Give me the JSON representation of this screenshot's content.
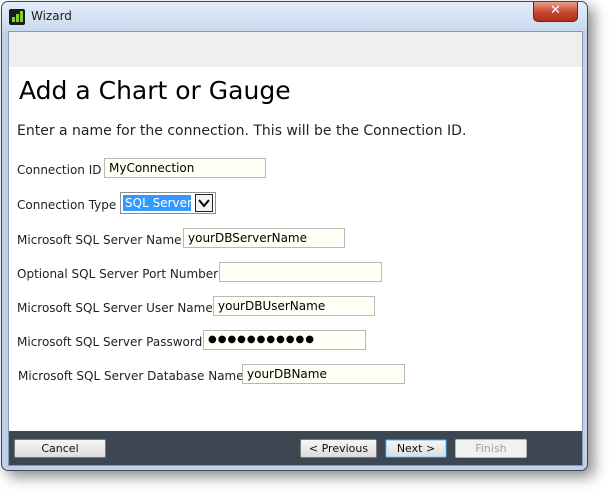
{
  "window": {
    "title": "Wizard",
    "close_glyph": "✕"
  },
  "page": {
    "heading": "Add a Chart or Gauge",
    "instruction": "Enter a name for the connection. This will be the Connection ID."
  },
  "form": {
    "connection_id": {
      "label": "Connection ID",
      "value": "MyConnection"
    },
    "connection_type": {
      "label": "Connection Type",
      "selected": "SQL Server"
    },
    "server_name": {
      "label": "Microsoft SQL Server Name",
      "value": "yourDBServerName"
    },
    "port": {
      "label": "Optional SQL Server Port Number",
      "value": ""
    },
    "user_name": {
      "label": "Microsoft SQL Server User Name",
      "value": "yourDBUserName"
    },
    "password": {
      "label": "Microsoft SQL Server Password",
      "value": "●●●●●●●●●●●"
    },
    "database_name": {
      "label": "Microsoft SQL Server Database Name",
      "value": "yourDBName"
    }
  },
  "buttons": {
    "cancel": "Cancel",
    "previous": "< Previous",
    "next": "Next >",
    "finish": "Finish"
  },
  "colors": {
    "selection": "#3399ff",
    "footer": "#3d4751",
    "close": "#c7452e"
  }
}
